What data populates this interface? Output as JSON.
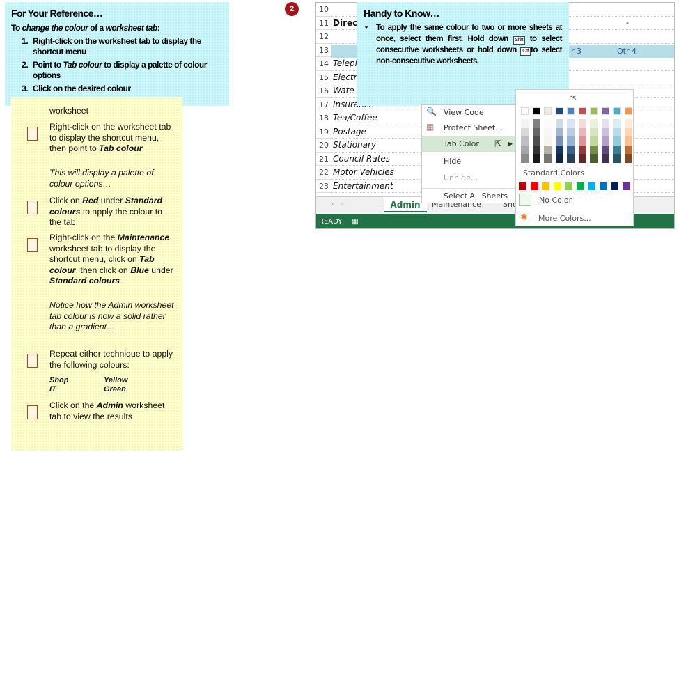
{
  "reference": {
    "title": "For Your Reference…",
    "intro_pre": "To ",
    "intro_em1": "change the colour",
    "intro_mid": " of a ",
    "intro_em2": "worksheet tab",
    "intro_post": ":",
    "steps": [
      {
        "pre": "Right-click on the worksheet tab to display the shortcut menu",
        "em": "",
        "post": ""
      },
      {
        "pre": "Point to ",
        "em": "Tab colour",
        "post": " to display a palette of colour options"
      },
      {
        "pre": "Click on the desired colour",
        "em": "",
        "post": ""
      }
    ]
  },
  "exercise": {
    "top_fragment": "worksheet",
    "s1a": "Right-click on the worksheet tab to display the shortcut menu, then point to ",
    "s1b": "Tab colour",
    "n1": "This will display a palette of colour options…",
    "s2a": "Click on ",
    "s2b": "Red",
    "s2c": " under ",
    "s2d": "Standard colours",
    "s2e": " to apply the colour to the tab",
    "s3a": "Right-click on the ",
    "s3b": "Maintenance",
    "s3c": " worksheet tab to display the shortcut menu, click on ",
    "s3d": "Tab colour",
    "s3e": ", then click on ",
    "s3f": "Blue",
    "s3g": " under ",
    "s3h": "Standard colours",
    "n3": "Notice how the Admin worksheet tab colour is now a solid rather than a gradient…",
    "s4": "Repeat either technique to apply the following colours:",
    "pairs": [
      {
        "sheet": "Shop",
        "colour": "Yellow"
      },
      {
        "sheet": "IT",
        "colour": "Green"
      }
    ],
    "s5a": "Click on the ",
    "s5b": "Admin",
    "s5c": " worksheet tab to view the results"
  },
  "badge": "2",
  "excel": {
    "rows": [
      {
        "n": "10",
        "label": ""
      },
      {
        "n": "11",
        "label": "Direct"
      },
      {
        "n": "12",
        "label": ""
      },
      {
        "n": "13",
        "label": ""
      },
      {
        "n": "14",
        "label": "Teleph"
      },
      {
        "n": "15",
        "label": "Electr"
      },
      {
        "n": "16",
        "label": "Wate"
      },
      {
        "n": "17",
        "label": "Insurance"
      },
      {
        "n": "18",
        "label": "Tea/Coffee"
      },
      {
        "n": "19",
        "label": "Postage"
      },
      {
        "n": "20",
        "label": "Stationary"
      },
      {
        "n": "21",
        "label": "Council Rates"
      },
      {
        "n": "22",
        "label": "Motor Vehicles"
      },
      {
        "n": "23",
        "label": "Entertainment"
      }
    ],
    "dash": "-",
    "qtr3": "r 3",
    "qtr4": "Qtr 4",
    "tabs": [
      "Admin",
      "Maintenance",
      "Sho"
    ],
    "status": "READY"
  },
  "handy": {
    "title": "Handy to Know…",
    "t1": "To apply the same colour to two or more sheets at once, select them first. Hold down ",
    "k1": "Shift",
    "t2": " to select consecutive worksheets or hold down ",
    "k2": "Ctrl",
    "t3": "to select non-consecutive worksheets."
  },
  "menu": {
    "items": [
      "View Code",
      "Protect Sheet...",
      "Tab Color",
      "Hide",
      "Unhide...",
      "Select All Sheets"
    ]
  },
  "palette": {
    "theme_label": "rs",
    "standard_label": "Standard Colors",
    "no_color": "No Color",
    "more_colors": "More Colors...",
    "theme": [
      "#FFFFFF",
      "#000000",
      "#EEECE1",
      "#1F497D",
      "#4F81BD",
      "#C0504D",
      "#9BBB59",
      "#8064A2",
      "#4BACC6",
      "#F79646"
    ],
    "standard": [
      "#C00000",
      "#FF0000",
      "#FFC000",
      "#FFFF00",
      "#92D050",
      "#00B050",
      "#00B0F0",
      "#0070C0",
      "#002060",
      "#7030A0"
    ]
  },
  "colors": {
    "status_green": "#217346",
    "tab_green": "#217346",
    "badge": "#a3161b"
  }
}
